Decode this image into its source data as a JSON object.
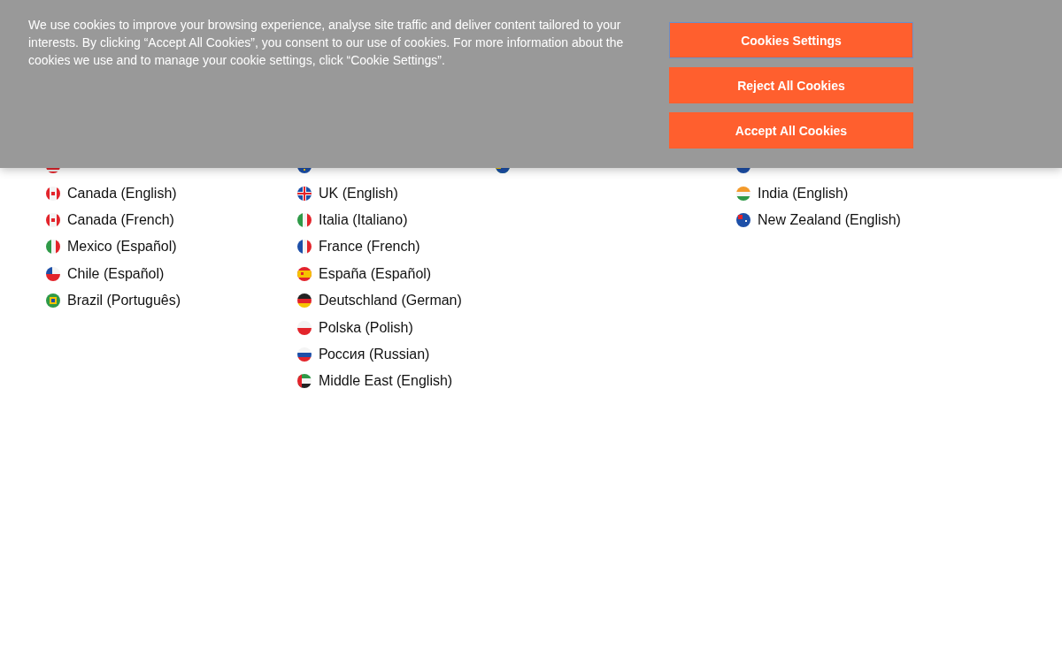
{
  "cookie_banner": {
    "message": "We use cookies to improve your browsing experience, analyse site traffic and deliver content tailored to your interests. By clicking “Accept All Cookies”, you consent to our use of cookies. For more information about the cookies we use and to manage your cookie settings, click “Cookie Settings”.",
    "buttons": [
      {
        "label": "Cookies Settings"
      },
      {
        "label": "Reject All Cookies"
      },
      {
        "label": "Accept All Cookies"
      }
    ]
  },
  "regions": [
    {
      "items": [
        "Canada (English)",
        "Canada (French)",
        "Mexico (Español)",
        "Chile (Español)",
        "Brazil (Português)"
      ]
    },
    {
      "items": [
        "UK (English)",
        "Italia (Italiano)",
        "France (French)",
        "España (Español)",
        "Deutschland (German)",
        "Polska (Polish)",
        "Россия (Russian)",
        "Middle East (English)"
      ]
    },
    {
      "items": [
        "India (English)",
        "New Zealand (English)"
      ]
    }
  ]
}
